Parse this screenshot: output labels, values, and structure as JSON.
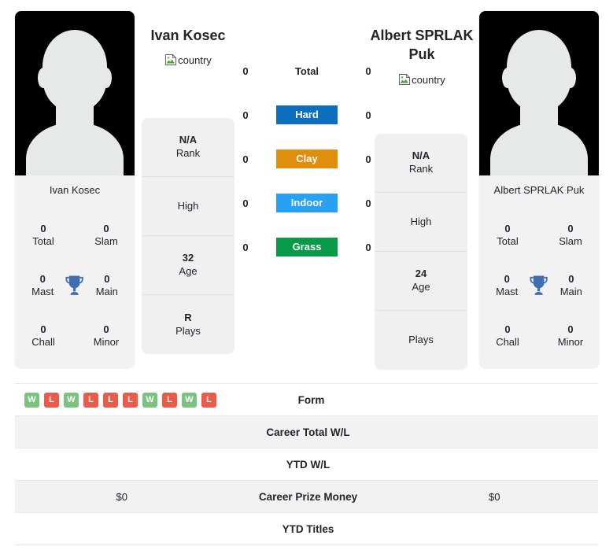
{
  "players": {
    "left": {
      "name": "Ivan Kosec",
      "country_alt": "country",
      "photo_caption": "Ivan Kosec",
      "trophies": [
        {
          "num": "0",
          "label": "Total"
        },
        {
          "num": "0",
          "label": "Slam"
        },
        {
          "num": "0",
          "label": "Mast"
        },
        {
          "num": "0",
          "label": "Main"
        },
        {
          "num": "0",
          "label": "Chall"
        },
        {
          "num": "0",
          "label": "Minor"
        }
      ],
      "info": [
        {
          "value": "N/A",
          "label": "Rank"
        },
        {
          "value": "",
          "label": "High"
        },
        {
          "value": "32",
          "label": "Age"
        },
        {
          "value": "R",
          "label": "Plays"
        }
      ],
      "form": [
        "W",
        "L",
        "W",
        "L",
        "L",
        "L",
        "W",
        "L",
        "W",
        "L"
      ],
      "career_total_wl": "",
      "ytd_wl": "",
      "career_prize_money": "$0",
      "ytd_titles": ""
    },
    "right": {
      "name": "Albert SPRLAK Puk",
      "country_alt": "country",
      "photo_caption": "Albert SPRLAK Puk",
      "trophies": [
        {
          "num": "0",
          "label": "Total"
        },
        {
          "num": "0",
          "label": "Slam"
        },
        {
          "num": "0",
          "label": "Mast"
        },
        {
          "num": "0",
          "label": "Main"
        },
        {
          "num": "0",
          "label": "Chall"
        },
        {
          "num": "0",
          "label": "Minor"
        }
      ],
      "info": [
        {
          "value": "N/A",
          "label": "Rank"
        },
        {
          "value": "",
          "label": "High"
        },
        {
          "value": "24",
          "label": "Age"
        },
        {
          "value": "",
          "label": "Plays"
        }
      ],
      "form": [],
      "career_total_wl": "",
      "ytd_wl": "",
      "career_prize_money": "$0",
      "ytd_titles": ""
    }
  },
  "surfaces": [
    {
      "label": "Total",
      "left": "0",
      "right": "0",
      "color": "",
      "plain": true
    },
    {
      "label": "Hard",
      "left": "0",
      "right": "0",
      "color": "#0d6ebd",
      "plain": false
    },
    {
      "label": "Clay",
      "left": "0",
      "right": "0",
      "color": "#e08e0b",
      "plain": false
    },
    {
      "label": "Indoor",
      "left": "0",
      "right": "0",
      "color": "#28a1f5",
      "plain": false
    },
    {
      "label": "Grass",
      "left": "0",
      "right": "0",
      "color": "#089949",
      "plain": false
    }
  ],
  "stats_rows": [
    {
      "label": "Form",
      "striped": false
    },
    {
      "label": "Career Total W/L",
      "striped": true
    },
    {
      "label": "YTD W/L",
      "striped": false
    },
    {
      "label": "Career Prize Money",
      "striped": true
    },
    {
      "label": "YTD Titles",
      "striped": false
    }
  ],
  "colors": {
    "hard": "#0d6ebd",
    "clay": "#e08e0b",
    "indoor": "#28a1f5",
    "grass": "#089949",
    "win": "#7ac47f",
    "loss": "#ea5b4a",
    "trophy": "#3f6fb2",
    "card_bg": "#f2f2f2"
  }
}
